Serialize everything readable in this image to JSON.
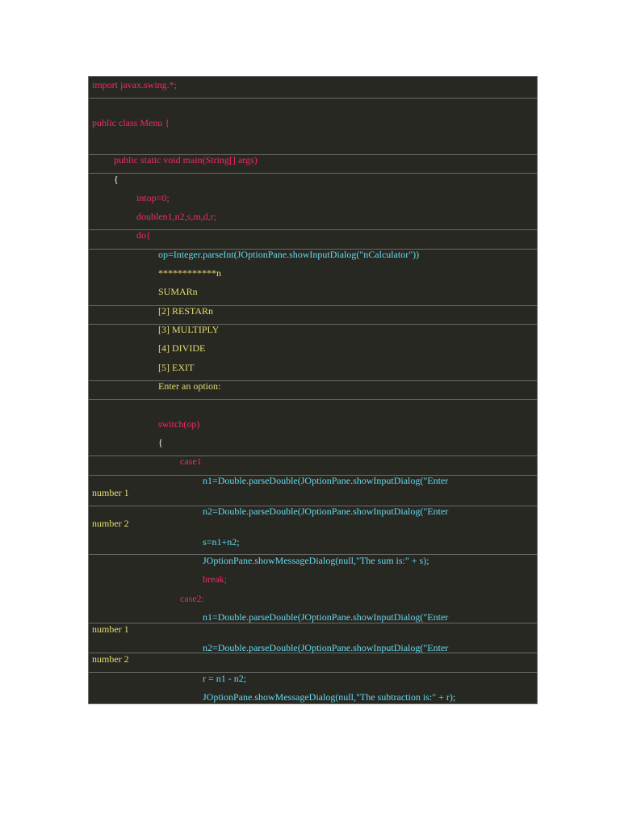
{
  "colors": {
    "background": "#272822",
    "keyword": "#f92672",
    "string": "#e6db74",
    "method": "#66d9ef",
    "plain": "#f8f8f2"
  },
  "code": {
    "lines": [
      {
        "text": "import javax.swing.*;",
        "color": "#f92672"
      },
      {
        "text": "public class Menu {",
        "color": "#f92672"
      },
      {
        "text": "public static void main(String[] args)",
        "color": "#f92672"
      },
      {
        "text": "{",
        "color": "#f8f8f2"
      },
      {
        "text": "intop=0;",
        "color": "#f92672"
      },
      {
        "text": "doublen1,n2,s,m,d,r;",
        "color": "#f92672"
      },
      {
        "text": "do{",
        "color": "#f92672"
      },
      {
        "text": "op=Integer.parseInt(JOptionPane.showInputDialog(\"nCalculator\"))",
        "color": "#66d9ef"
      },
      {
        "text": "************n",
        "color": "#e6db74"
      },
      {
        "text": "SUMARn",
        "color": "#e6db74"
      },
      {
        "text": "[2] RESTARn",
        "color": "#e6db74"
      },
      {
        "text": "[3] MULTIPLY",
        "color": "#e6db74"
      },
      {
        "text": "[4] DIVIDE",
        "color": "#e6db74"
      },
      {
        "text": "[5] EXIT",
        "color": "#e6db74"
      },
      {
        "text": "Enter an option:",
        "color": "#e6db74"
      },
      {
        "text": "switch(op)",
        "color": "#f92672"
      },
      {
        "text": "{",
        "color": "#f8f8f2"
      },
      {
        "text": "case1",
        "color": "#f92672"
      },
      {
        "text": "n1=Double.parseDouble(JOptionPane.showInputDialog(\"Enter",
        "color": "#66d9ef"
      },
      {
        "text": "number 1",
        "color": "#e6db74"
      },
      {
        "text": "n2=Double.parseDouble(JOptionPane.showInputDialog(\"Enter",
        "color": "#66d9ef"
      },
      {
        "text": "number 2",
        "color": "#e6db74"
      },
      {
        "text": "s=n1+n2;",
        "color": "#66d9ef"
      },
      {
        "text": "JOptionPane.showMessageDialog(null,\"The sum is:\" + s);",
        "color": "#66d9ef"
      },
      {
        "text": "break;",
        "color": "#f92672"
      },
      {
        "text": "case2:",
        "color": "#f92672"
      },
      {
        "text": "n1=Double.parseDouble(JOptionPane.showInputDialog(\"Enter",
        "color": "#66d9ef"
      },
      {
        "text": "number 1",
        "color": "#e6db74"
      },
      {
        "text": "n2=Double.parseDouble(JOptionPane.showInputDialog(\"Enter",
        "color": "#66d9ef"
      },
      {
        "text": "number 2",
        "color": "#e6db74"
      },
      {
        "text": "r = n1 - n2;",
        "color": "#66d9ef"
      },
      {
        "text": "JOptionPane.showMessageDialog(null,\"The subtraction is:\" + r);",
        "color": "#66d9ef"
      }
    ]
  }
}
